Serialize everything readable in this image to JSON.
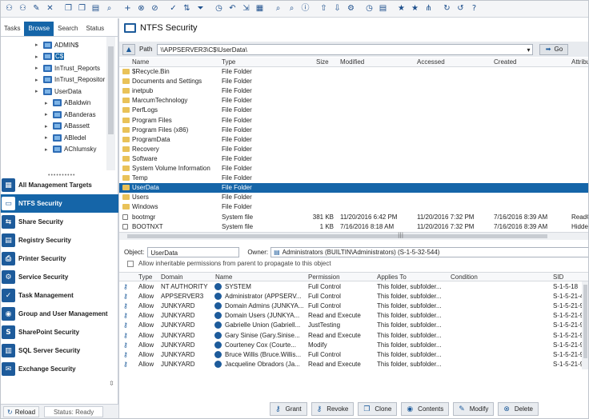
{
  "toolbar": {
    "icons": [
      "agent-icon",
      "add-agent-icon",
      "edit-agent-icon",
      "remove-agent-icon",
      "copy-icon",
      "paste-icon",
      "report-icon",
      "find-icon",
      "add-icon",
      "delete-icon",
      "cancel-icon",
      "check-icon",
      "sort-icon",
      "filter-icon",
      "time-icon",
      "undo-icon",
      "expand-icon",
      "view-icon",
      "search-icon",
      "global-search-icon",
      "info-icon",
      "export-icon",
      "import-icon",
      "settings-icon",
      "schedule-icon",
      "server-icon",
      "star-icon",
      "favorites-icon",
      "tree-icon",
      "refresh-icon",
      "reload-icon",
      "help-icon"
    ]
  },
  "left": {
    "tabs": [
      "Tasks",
      "Browse",
      "Search",
      "Status"
    ],
    "active_tab": "Browse",
    "tree": [
      {
        "label": "ADMIN$",
        "level": 1
      },
      {
        "label": "C$",
        "level": 1,
        "selected": true
      },
      {
        "label": "InTrust_Reports",
        "level": 1
      },
      {
        "label": "InTrust_Repositor",
        "level": 1
      },
      {
        "label": "UserData",
        "level": 1
      },
      {
        "label": "ABaldwin",
        "level": 2
      },
      {
        "label": "ABanderas",
        "level": 2
      },
      {
        "label": "ABassett",
        "level": 2
      },
      {
        "label": "ABledel",
        "level": 2
      },
      {
        "label": "AChlumsky",
        "level": 2
      }
    ],
    "nav": [
      {
        "label": "All Management Targets",
        "icon": "targets-icon",
        "glyph": "▦"
      },
      {
        "label": "NTFS Security",
        "icon": "ntfs-icon",
        "glyph": "▭",
        "active": true
      },
      {
        "label": "Share Security",
        "icon": "share-icon",
        "glyph": "⇆"
      },
      {
        "label": "Registry Security",
        "icon": "registry-icon",
        "glyph": "▤"
      },
      {
        "label": "Printer Security",
        "icon": "printer-icon",
        "glyph": "⎙"
      },
      {
        "label": "Service Security",
        "icon": "service-icon",
        "glyph": "⚙"
      },
      {
        "label": "Task Management",
        "icon": "task-icon",
        "glyph": "✓"
      },
      {
        "label": "Group and User Management",
        "icon": "group-icon",
        "glyph": "◉"
      },
      {
        "label": "SharePoint Security",
        "icon": "sharepoint-icon",
        "glyph": "S"
      },
      {
        "label": "SQL Server Security",
        "icon": "sql-icon",
        "glyph": "▥"
      },
      {
        "label": "Exchange Security",
        "icon": "exchange-icon",
        "glyph": "✉"
      }
    ],
    "reload_label": "Reload",
    "status_label": "Status: Ready"
  },
  "main": {
    "title": "NTFS Security",
    "path_label": "Path",
    "path_value": "\\\\APPSERVER3\\C$\\UserData\\",
    "go_label": "Go",
    "file_columns": [
      "Name",
      "Type",
      "Size",
      "Modified",
      "Accessed",
      "Created",
      "Attribu"
    ],
    "files": [
      {
        "name": "$Recycle.Bin",
        "type": "File Folder",
        "size": "",
        "modified": "",
        "accessed": "",
        "created": "",
        "attrib": ""
      },
      {
        "name": "Documents and Settings",
        "type": "File Folder",
        "size": "",
        "modified": "",
        "accessed": "",
        "created": "",
        "attrib": ""
      },
      {
        "name": "inetpub",
        "type": "File Folder",
        "size": "",
        "modified": "",
        "accessed": "",
        "created": "",
        "attrib": ""
      },
      {
        "name": "MarcumTechnology",
        "type": "File Folder",
        "size": "",
        "modified": "",
        "accessed": "",
        "created": "",
        "attrib": ""
      },
      {
        "name": "PerfLogs",
        "type": "File Folder",
        "size": "",
        "modified": "",
        "accessed": "",
        "created": "",
        "attrib": ""
      },
      {
        "name": "Program Files",
        "type": "File Folder",
        "size": "",
        "modified": "",
        "accessed": "",
        "created": "",
        "attrib": ""
      },
      {
        "name": "Program Files (x86)",
        "type": "File Folder",
        "size": "",
        "modified": "",
        "accessed": "",
        "created": "",
        "attrib": ""
      },
      {
        "name": "ProgramData",
        "type": "File Folder",
        "size": "",
        "modified": "",
        "accessed": "",
        "created": "",
        "attrib": ""
      },
      {
        "name": "Recovery",
        "type": "File Folder",
        "size": "",
        "modified": "",
        "accessed": "",
        "created": "",
        "attrib": ""
      },
      {
        "name": "Software",
        "type": "File Folder",
        "size": "",
        "modified": "",
        "accessed": "",
        "created": "",
        "attrib": ""
      },
      {
        "name": "System Volume Information",
        "type": "File Folder",
        "size": "",
        "modified": "",
        "accessed": "",
        "created": "",
        "attrib": ""
      },
      {
        "name": "Temp",
        "type": "File Folder",
        "size": "",
        "modified": "",
        "accessed": "",
        "created": "",
        "attrib": ""
      },
      {
        "name": "UserData",
        "type": "File Folder",
        "size": "",
        "modified": "",
        "accessed": "",
        "created": "",
        "attrib": "",
        "selected": true
      },
      {
        "name": "Users",
        "type": "File Folder",
        "size": "",
        "modified": "",
        "accessed": "",
        "created": "",
        "attrib": ""
      },
      {
        "name": "Windows",
        "type": "File Folder",
        "size": "",
        "modified": "",
        "accessed": "",
        "created": "",
        "attrib": ""
      },
      {
        "name": "bootmgr",
        "type": "System file",
        "size": "381 KB",
        "modified": "11/20/2016 6:42 PM",
        "accessed": "11/20/2016 7:32 PM",
        "created": "7/16/2016 8:39 AM",
        "attrib": "ReadO",
        "file": true
      },
      {
        "name": "BOOTNXT",
        "type": "System file",
        "size": "1 KB",
        "modified": "7/16/2016 8:18 AM",
        "accessed": "11/20/2016 7:32 PM",
        "created": "7/16/2016 8:39 AM",
        "attrib": "Hidden",
        "file": true
      }
    ],
    "object_label": "Object:",
    "object_value": "UserData",
    "owner_label": "Owner:",
    "owner_value": "Administrators (BUILTIN\\Administrators) (S-1-5-32-544)",
    "inherit_label": "Allow inheritable permissions from parent to propagate to this object",
    "acl_columns": [
      "Type",
      "Domain",
      "Name",
      "Permission",
      "Applies To",
      "Condition",
      "SID"
    ],
    "acl": [
      {
        "type": "Allow",
        "domain": "NT AUTHORITY",
        "name": "SYSTEM",
        "permission": "Full Control",
        "applies": "This folder, subfolder...",
        "condition": "",
        "sid": "S-1-5-18"
      },
      {
        "type": "Allow",
        "domain": "APPSERVER3",
        "name": "Administrator (APPSERV...",
        "permission": "Full Control",
        "applies": "This folder, subfolder...",
        "condition": "",
        "sid": "S-1-5-21-41"
      },
      {
        "type": "Allow",
        "domain": "JUNKYARD",
        "name": "Domain Admins (JUNKYA...",
        "permission": "Full Control",
        "applies": "This folder, subfolder...",
        "condition": "",
        "sid": "S-1-5-21-98"
      },
      {
        "type": "Allow",
        "domain": "JUNKYARD",
        "name": "Domain Users (JUNKYA...",
        "permission": "Read and Execute",
        "applies": "This folder, subfolder...",
        "condition": "",
        "sid": "S-1-5-21-98"
      },
      {
        "type": "Allow",
        "domain": "JUNKYARD",
        "name": "Gabrielle Union (Gabriell...",
        "permission": "JustTesting",
        "applies": "This folder, subfolder...",
        "condition": "",
        "sid": "S-1-5-21-98"
      },
      {
        "type": "Allow",
        "domain": "JUNKYARD",
        "name": "Gary Sinise (Gary.Sinise...",
        "permission": "Read and Execute",
        "applies": "This folder, subfolder...",
        "condition": "",
        "sid": "S-1-5-21-98"
      },
      {
        "type": "Allow",
        "domain": "JUNKYARD",
        "name": "Courteney Cox (Courte...",
        "permission": "Modify",
        "applies": "This folder, subfolder...",
        "condition": "",
        "sid": "S-1-5-21-98"
      },
      {
        "type": "Allow",
        "domain": "JUNKYARD",
        "name": "Bruce Willis (Bruce.Willis...",
        "permission": "Full Control",
        "applies": "This folder, subfolder...",
        "condition": "",
        "sid": "S-1-5-21-98"
      },
      {
        "type": "Allow",
        "domain": "JUNKYARD",
        "name": "Jacqueline Obradors (Ja...",
        "permission": "Read and Execute",
        "applies": "This folder, subfolder...",
        "condition": "",
        "sid": "S-1-5-21-98"
      }
    ],
    "actions": [
      {
        "label": "Grant",
        "icon": "grant-icon",
        "glyph": "⚷"
      },
      {
        "label": "Revoke",
        "icon": "revoke-icon",
        "glyph": "⚷"
      },
      {
        "label": "Clone",
        "icon": "clone-icon",
        "glyph": "❐"
      },
      {
        "label": "Contents",
        "icon": "contents-icon",
        "glyph": "◉"
      },
      {
        "label": "Modify",
        "icon": "modify-icon",
        "glyph": "✎"
      },
      {
        "label": "Delete",
        "icon": "delete-icon",
        "glyph": "⊗"
      }
    ]
  },
  "colors": {
    "accent": "#1565a8",
    "folder": "#e9c259"
  }
}
